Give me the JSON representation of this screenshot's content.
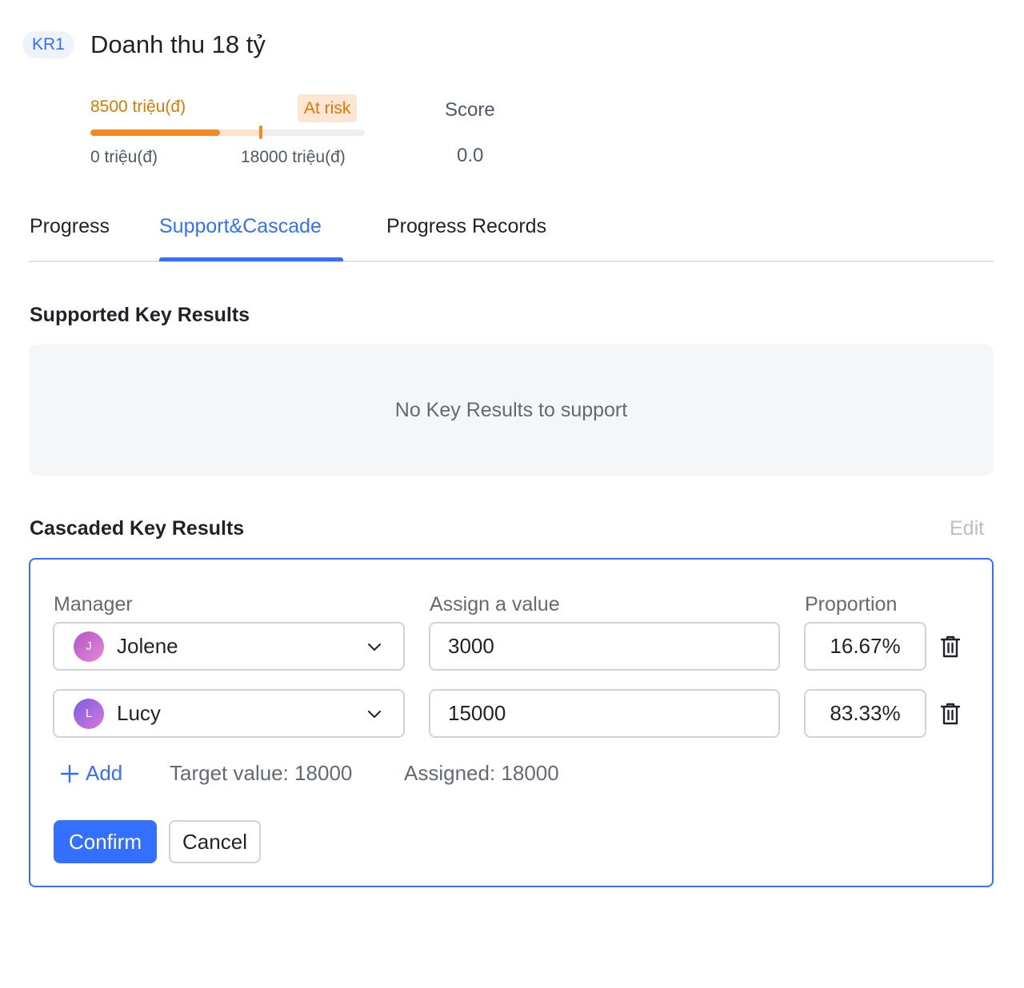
{
  "header": {
    "kr_badge": "KR1",
    "title": "Doanh thu 18 tỷ"
  },
  "progress": {
    "current_value_text": "8500 triệu(đ)",
    "status_badge": "At risk",
    "min_text": "0 triệu(đ)",
    "max_text": "18000 triệu(đ)",
    "current_fraction": 0.472,
    "expected_fraction": 0.62,
    "status_color": "#f08a24"
  },
  "score": {
    "label": "Score",
    "value": "0.0"
  },
  "tabs": [
    {
      "label": "Progress",
      "active": false
    },
    {
      "label": "Support&Cascade",
      "active": true
    },
    {
      "label": "Progress Records",
      "active": false
    }
  ],
  "supported": {
    "title": "Supported Key Results",
    "empty_text": "No Key Results to support"
  },
  "cascaded": {
    "title": "Cascaded Key Results",
    "edit_label": "Edit",
    "columns": {
      "manager": "Manager",
      "assign": "Assign a value",
      "proportion": "Proportion"
    },
    "rows": [
      {
        "avatar_initial": "J",
        "manager": "Jolene",
        "value": "3000",
        "proportion": "16.67%"
      },
      {
        "avatar_initial": "L",
        "manager": "Lucy",
        "value": "15000",
        "proportion": "83.33%"
      }
    ],
    "add_label": "Add",
    "target_text": "Target value: 18000",
    "assigned_text": "Assigned: 18000",
    "confirm_label": "Confirm",
    "cancel_label": "Cancel"
  },
  "colors": {
    "accent": "#3370ff",
    "warning": "#de7802"
  }
}
